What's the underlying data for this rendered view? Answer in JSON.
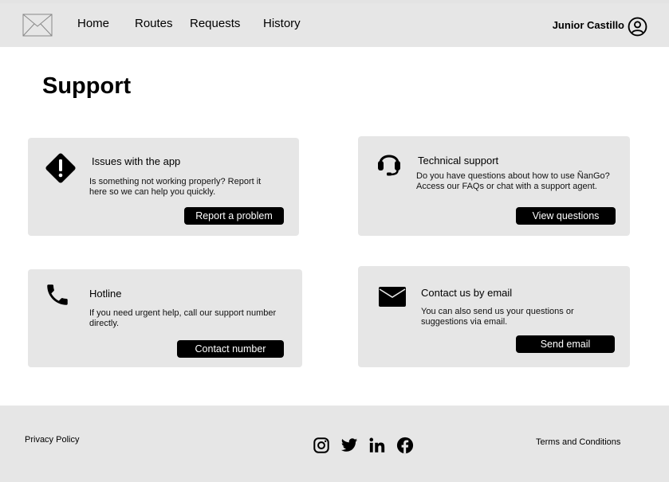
{
  "header": {
    "logo": "image-placeholder-logo",
    "nav": [
      "Home",
      "Routes",
      "Requests",
      "History"
    ],
    "user_name": "Junior Castillo",
    "user_icon": "user-circle-icon"
  },
  "page": {
    "title": "Support"
  },
  "cards": [
    {
      "icon": "warning-diamond-icon",
      "title": "Issues with the app",
      "description": "Is something not working properly? Report it here so we can help you quickly.",
      "button": "Report a problem"
    },
    {
      "icon": "headset-icon",
      "title": "Technical support",
      "description": "Do you have questions about how to use ÑanGo? Access our FAQs or chat with a support agent.",
      "button": "View questions"
    },
    {
      "icon": "phone-icon",
      "title": "Hotline",
      "description": "If you need urgent help, call our support number directly.",
      "button": "Contact number"
    },
    {
      "icon": "envelope-icon",
      "title": "Contact us by email",
      "description": "You can also send us your questions or suggestions via email.",
      "button": "Send email"
    }
  ],
  "footer": {
    "privacy": "Privacy Policy",
    "terms": "Terms and Conditions",
    "social": [
      "instagram-icon",
      "twitter-icon",
      "linkedin-icon",
      "facebook-icon"
    ]
  },
  "colors": {
    "header_bg": "#e6e6e6",
    "card_bg": "#e6e6e6",
    "button_bg": "#000000",
    "button_text": "#ffffff"
  }
}
